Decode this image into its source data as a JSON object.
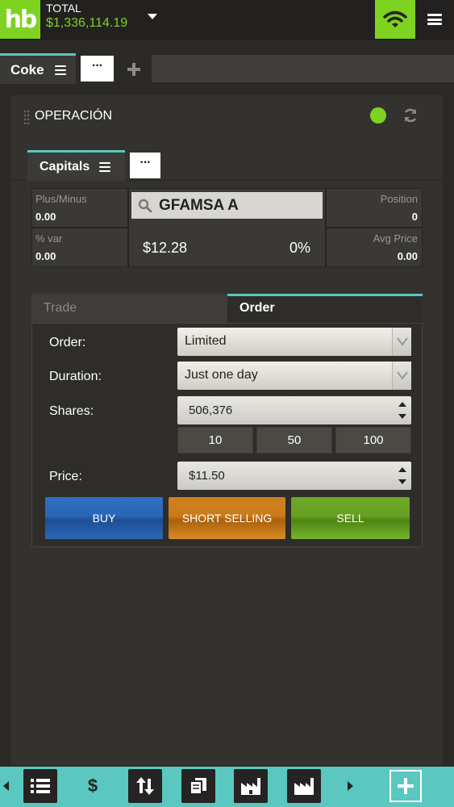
{
  "header": {
    "logo_text": "hb",
    "total_label": "TOTAL",
    "total_value": "$1,336,114.19",
    "accent_color": "#7ed321"
  },
  "workspace_tabs": {
    "active_label": "Coke",
    "more_label": "···"
  },
  "panel": {
    "title": "OPERACIÓN",
    "connection_status": "connected",
    "status_color": "#7ed321",
    "tab_label": "Capitals",
    "more_label": "···"
  },
  "quote": {
    "plus_minus_label": "Plus/Minus",
    "plus_minus_value": "0.00",
    "pct_var_label": "% var",
    "pct_var_value": "0.00",
    "symbol": "GFAMSA A",
    "last_price": "$12.28",
    "change_pct": "0%",
    "position_label": "Position",
    "position_value": "0",
    "avg_price_label": "Avg Price",
    "avg_price_value": "0.00"
  },
  "order_tabs": {
    "trade_label": "Trade",
    "order_label": "Order",
    "active": "Order"
  },
  "order_form": {
    "order_label": "Order:",
    "order_value": "Limited",
    "duration_label": "Duration:",
    "duration_value": "Just one day",
    "shares_label": "Shares:",
    "shares_value": "506,376",
    "quick_qty": [
      "10",
      "50",
      "100"
    ],
    "price_label": "Price:",
    "price_value": "$11.50",
    "buy_label": "BUY",
    "short_label": "SHORT SELLING",
    "sell_label": "SELL"
  },
  "bottom_bar": {
    "accent_color": "#5ac8c0",
    "items": [
      "list-icon",
      "dollar-icon",
      "transfer-icon",
      "documents-icon",
      "factory-icon",
      "factory-icon",
      "add-icon"
    ],
    "dollar_symbol": "$"
  }
}
